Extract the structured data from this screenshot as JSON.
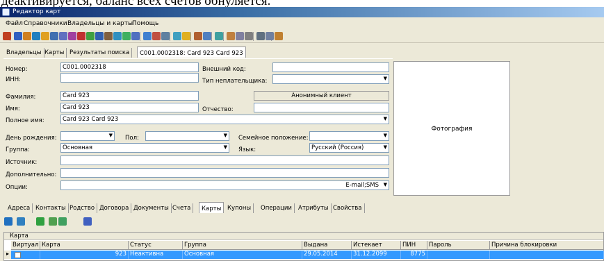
{
  "caption_text": "деактивируется, баланс всех счетов обнуляется.",
  "window": {
    "title": "Редактор карт"
  },
  "menu": [
    "Файл",
    "Справочники",
    "Владельцы и карты",
    "Помощь"
  ],
  "toolbar_icons": [
    "open-icon",
    "link-icon",
    "settings-icon",
    "globe-icon",
    "wand-icon",
    "find-icon",
    "table-icon",
    "edit-icon",
    "gem-icon",
    "export-icon",
    "help-icon",
    "book-icon",
    "database-icon",
    "database-icon",
    "people-icon",
    "clock-icon",
    "page-icon",
    "report-icon",
    "clock-icon",
    "star-icon",
    "cards-icon",
    "report-icon",
    "tool-icon",
    "user-icon",
    "user-icon",
    "user-icon",
    "users-icon",
    "users-icon",
    "user-icon"
  ],
  "main_tabs": [
    "Владельцы",
    "Карты",
    "Результаты поиска",
    "C001.0002318: Card 923 Card 923"
  ],
  "form": {
    "number_label": "Номер:",
    "number_value": "C001.0002318",
    "inn_label": "ИНН:",
    "inn_value": "",
    "external_code_label": "Внешний код:",
    "external_code_value": "",
    "taxpayer_type_label": "Тип неплательщика:",
    "taxpayer_type_value": "",
    "surname_label": "Фамилия:",
    "surname_value": "Card 923",
    "anonymous_button": "Анонимный клиент",
    "name_label": "Имя:",
    "name_value": "Card 923",
    "patronymic_label": "Отчество:",
    "patronymic_value": "",
    "full_name_label": "Полное имя:",
    "full_name_value": "Card 923 Card 923",
    "birthday_label": "День рождения:",
    "birthday_value": "",
    "gender_label": "Пол:",
    "gender_value": "",
    "marital_label": "Семейное положение:",
    "marital_value": "",
    "group_label": "Группа:",
    "group_value": "Основная",
    "language_label": "Язык:",
    "language_value": "Русский (Россия)",
    "source_label": "Источник:",
    "source_value": "",
    "extra_label": "Дополнительно:",
    "extra_value": "",
    "options_label": "Опции:",
    "options_value": "E-mail;SMS"
  },
  "photo_label": "Фотография",
  "detail_tabs": [
    "Адреса",
    "Контакты",
    "Родство",
    "Договора",
    "Документы",
    "Счета",
    "Карты",
    "Купоны",
    "Операции",
    "Атрибуты",
    "Свойства"
  ],
  "detail_active_tab": "Карты",
  "cards_toolbar_icons": [
    "new-icon",
    "edit-icon",
    "money-icon",
    "money-icon",
    "money-icon",
    "users-icon"
  ],
  "grid": {
    "group_header": "Карта",
    "columns": [
      "Виртуал",
      "Карта",
      "Статус",
      "Группа",
      "Выдана",
      "Истекает",
      "ПИН",
      "Пароль",
      "Причина блокировки"
    ],
    "rows": [
      {
        "virtual": false,
        "card": "923",
        "status": "Неактивна",
        "group": "Основная",
        "issued": "29.05.2014",
        "expires": "31.12.2099",
        "pin": "8775",
        "password": "",
        "block_reason": ""
      }
    ]
  }
}
